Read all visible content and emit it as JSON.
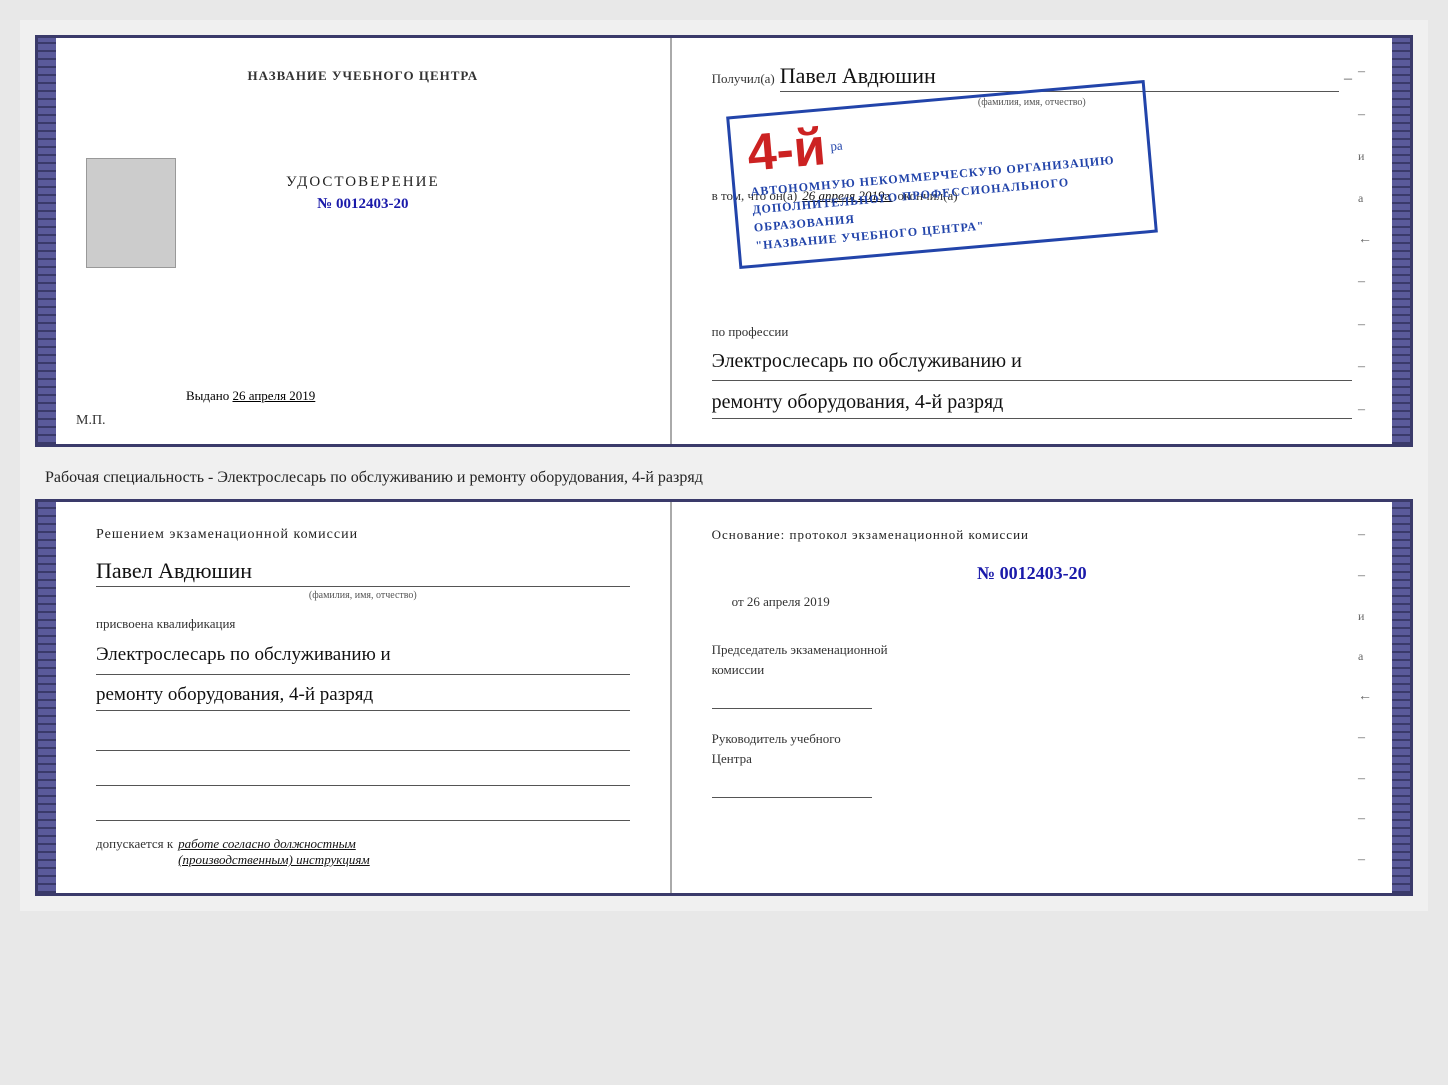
{
  "certificate": {
    "left": {
      "training_center_title": "НАЗВАНИЕ УЧЕБНОГО ЦЕНТРА",
      "doc_label": "УДОСТОВЕРЕНИЕ",
      "doc_number_prefix": "№",
      "doc_number": "0012403-20",
      "issued_label": "Выдано",
      "issued_date": "26 апреля 2019",
      "mp_label": "М.П."
    },
    "right": {
      "received_label": "Получил(а)",
      "recipient_name": "Павел Авдюшин",
      "fio_subtitle": "(фамилия, имя, отчество)",
      "dash": "–",
      "vtom_prefix": "в том, что он(а)",
      "vtom_date": "26 апреля 2019г.",
      "vtom_suffix": "окончил(а)",
      "stamp_line1": "АВТОНОМНУЮ НЕКОММЕРЧЕСКУЮ ОРГАНИЗАЦИЮ",
      "stamp_line2": "ДОПОЛНИТЕЛЬНОГО ПРОФЕССИОНАЛЬНОГО ОБРАЗОВАНИЯ",
      "stamp_quote_open": "\"",
      "stamp_center_name": "НАЗВАНИЕ УЧЕБНОГО ЦЕНТРА",
      "stamp_quote_close": "\"",
      "stamp_big_text": "4-й",
      "profession_label": "по профессии",
      "profession_line1": "Электрослесарь по обслуживанию и",
      "profession_line2": "ремонту оборудования, 4-й разряд"
    }
  },
  "middle_text": "Рабочая специальность - Электрослесарь по обслуживанию и ремонту оборудования, 4-й\nразряд",
  "qualification": {
    "left": {
      "decision_text": "Решением экзаменационной комиссии",
      "person_name": "Павел Авдюшин",
      "fio_subtitle": "(фамилия, имя, отчество)",
      "assigned_label": "присвоена квалификация",
      "profession_line1": "Электрослесарь по обслуживанию и",
      "profession_line2": "ремонту оборудования, 4-й разряд",
      "admits_label": "допускается к",
      "admits_italic": "работе согласно должностным\n(производственным) инструкциям"
    },
    "right": {
      "basis_text": "Основание: протокол экзаменационной комиссии",
      "protocol_number_prefix": "№",
      "protocol_number": "0012403-20",
      "protocol_date_prefix": "от",
      "protocol_date": "26 апреля 2019",
      "chairman_label": "Председатель экзаменационной\nкомиссии",
      "director_label": "Руководитель учебного\nЦентра"
    }
  },
  "side_marks": {
    "marks": [
      "и",
      "а",
      "←",
      "–",
      "–",
      "–",
      "–"
    ],
    "marks_bottom": [
      "и",
      "а",
      "←",
      "–",
      "–",
      "–",
      "–"
    ]
  }
}
